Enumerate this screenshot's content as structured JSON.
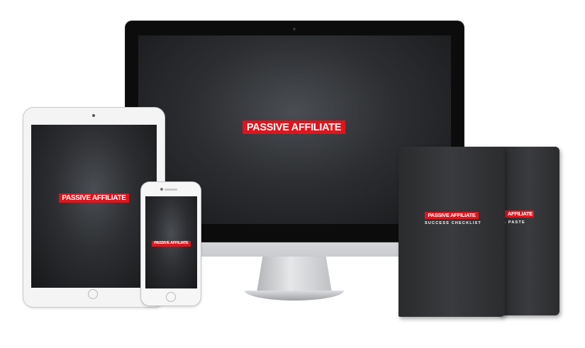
{
  "brand": {
    "logo_word1": "PASSIVE",
    "logo_word2": "AFFILIATE",
    "logo_red": "#e1141c"
  },
  "books": {
    "front_subtitle": "SUCCESS CHECKLIST",
    "back_subtitle_partial": "& PASTE"
  },
  "colors": {
    "screen_dark": "#2c2e31",
    "device_silver": "#e4e5e7",
    "book_body": "#333436"
  }
}
